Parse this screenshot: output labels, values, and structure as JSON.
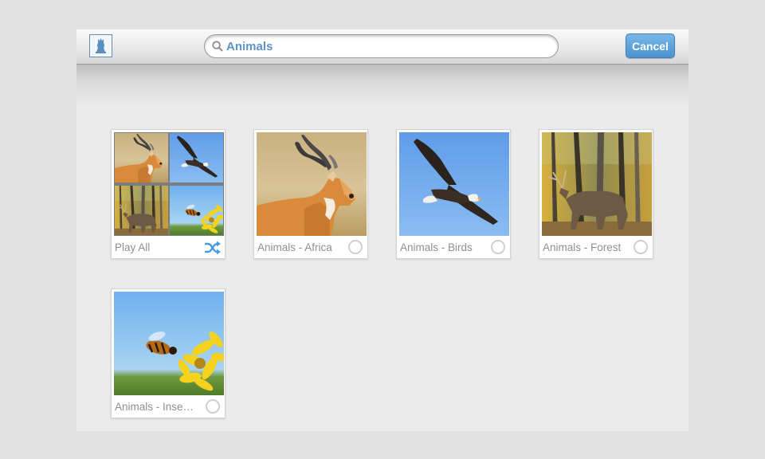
{
  "toolbar": {
    "search": {
      "value": "Animals"
    },
    "cancel_label": "Cancel",
    "app_icon": "chess-piece-icon"
  },
  "albums": [
    {
      "label": "Play All",
      "icon": "shuffle-icon"
    },
    {
      "label": "Animals - Africa",
      "selected": false
    },
    {
      "label": "Animals - Birds",
      "selected": false
    },
    {
      "label": "Animals - Forest",
      "selected": false
    },
    {
      "label": "Animals - Inse…",
      "selected": false
    }
  ],
  "colors": {
    "accent": "#5b93c6",
    "button": "#4a92cf",
    "label": "#8f8f8f",
    "background": "#ebebeb"
  }
}
